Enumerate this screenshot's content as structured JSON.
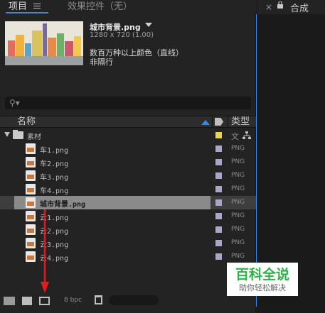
{
  "tabs": {
    "project_label": "项目",
    "effects_label": "效果控件（无）"
  },
  "preview": {
    "file_name": "城市背景.png",
    "dimensions": "1280 x 720 (1.00)",
    "color_info_line1": "数百万种以上颜色（直线）",
    "color_info_line2": "非隔行"
  },
  "columns": {
    "name": "名称",
    "type": "类型"
  },
  "tree": {
    "folder": {
      "name": "素材",
      "type": "文",
      "swatch": "#e8d44d"
    },
    "items": [
      {
        "name": "车1.png",
        "type": "PNG",
        "swatch": "#a9a6c9",
        "selected": false
      },
      {
        "name": "车2.png",
        "type": "PNG",
        "swatch": "#a9a6c9",
        "selected": false
      },
      {
        "name": "车3.png",
        "type": "PNG",
        "swatch": "#a9a6c9",
        "selected": false
      },
      {
        "name": "车4.png",
        "type": "PNG",
        "swatch": "#a9a6c9",
        "selected": false
      },
      {
        "name": "城市背景.png",
        "type": "PNG",
        "swatch": "#a9a6c9",
        "selected": true
      },
      {
        "name": "云1.png",
        "type": "PNG",
        "swatch": "#a9a6c9",
        "selected": false
      },
      {
        "name": "云2.png",
        "type": "PNG",
        "swatch": "#a9a6c9",
        "selected": false
      },
      {
        "name": "云3.png",
        "type": "PNG",
        "swatch": "#a9a6c9",
        "selected": false
      },
      {
        "name": "云4.png",
        "type": "PNG",
        "swatch": "#a9a6c9",
        "selected": false
      }
    ]
  },
  "toolbar": {
    "bpc": "8 bpc"
  },
  "right_panel": {
    "close_glyph": "×",
    "comp_tab_label": "合成"
  },
  "watermark": {
    "title": "百科全说",
    "subtitle": "助你轻松解决"
  },
  "colors": {
    "accent_blue": "#2d8ceb",
    "arrow_red": "#e01c1c",
    "watermark_green": "#2fb24a"
  }
}
